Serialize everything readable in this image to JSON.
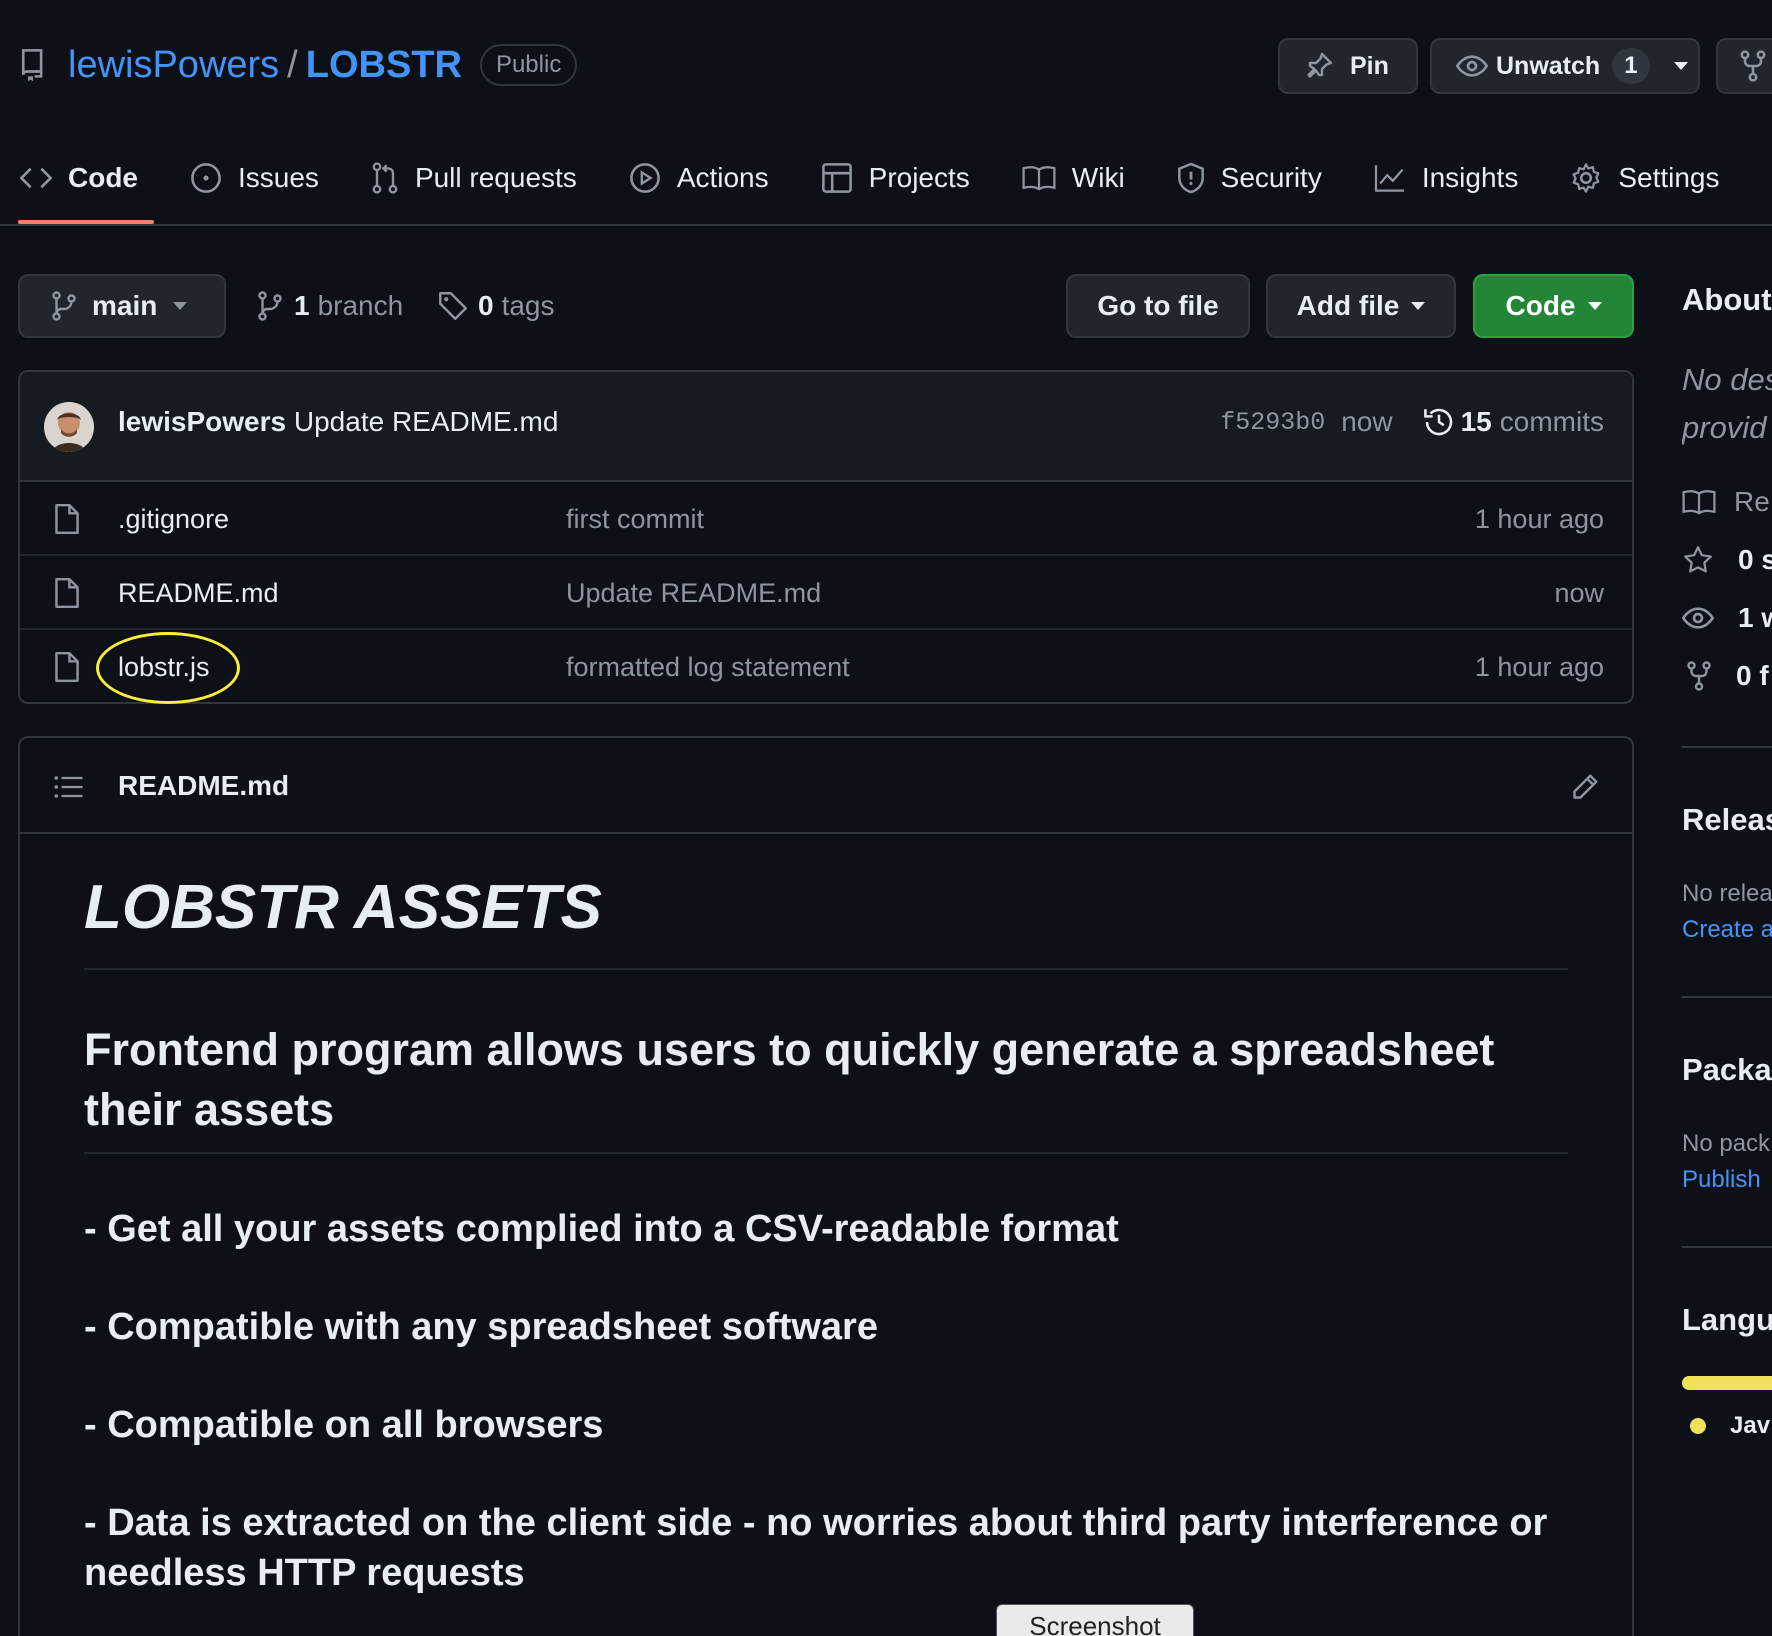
{
  "repo": {
    "owner": "lewisPowers",
    "separator": "/",
    "name": "LOBSTR",
    "visibility": "Public",
    "pin_label": "Pin",
    "watch_label": "Unwatch",
    "watch_count": "1"
  },
  "tabs": [
    {
      "label": "Code",
      "icon": "code-icon",
      "active": true
    },
    {
      "label": "Issues",
      "icon": "issue-icon"
    },
    {
      "label": "Pull requests",
      "icon": "pull-request-icon"
    },
    {
      "label": "Actions",
      "icon": "play-icon"
    },
    {
      "label": "Projects",
      "icon": "table-icon"
    },
    {
      "label": "Wiki",
      "icon": "book-icon"
    },
    {
      "label": "Security",
      "icon": "shield-icon"
    },
    {
      "label": "Insights",
      "icon": "graph-icon"
    },
    {
      "label": "Settings",
      "icon": "gear-icon"
    }
  ],
  "toolbar": {
    "branch": "main",
    "branch_count": "1",
    "branch_word": "branch",
    "tag_count": "0",
    "tag_word": "tags",
    "go_to_file": "Go to file",
    "add_file": "Add file",
    "code": "Code"
  },
  "commit": {
    "author": "lewisPowers",
    "message": "Update README.md",
    "sha": "f5293b0",
    "time": "now",
    "count": "15",
    "count_word": "commits"
  },
  "files": [
    {
      "name": ".gitignore",
      "message": "first commit",
      "time": "1 hour ago"
    },
    {
      "name": "README.md",
      "message": "Update README.md",
      "time": "now"
    },
    {
      "name": "lobstr.js",
      "message": "formatted log statement",
      "time": "1 hour ago"
    }
  ],
  "readme": {
    "filename": "README.md",
    "h1": "LOBSTR ASSETS",
    "h2_line1": "Frontend program allows users to quickly generate a spreadsheet",
    "h2_line2": "their assets",
    "items": [
      "- Get all your assets complied into a CSV-readable format",
      "- Compatible with any spreadsheet software",
      "- Compatible on all browsers"
    ],
    "item4_line1": "- Data is extracted on the client side - no worries about third party interference or",
    "item4_line2": "needless HTTP requests"
  },
  "sidebar": {
    "about": "About",
    "desc_line1": "No des",
    "desc_line2": "provid",
    "readme_stub": "Re",
    "stars": "0 s",
    "watching": "1 w",
    "forks": "0 f",
    "releases": "Releas",
    "no_releases": "No relea",
    "create_release": "Create a",
    "packages": "Packa",
    "no_packages": "No pack",
    "publish": "Publish",
    "languages": "Langu",
    "language_name": "Jav"
  },
  "tooltip": "Screenshot",
  "colors": {
    "background": "#0d1117",
    "accent_link": "#4493f8",
    "code_button": "#238636",
    "tab_underline": "#f78166",
    "language_js": "#f1e05a",
    "highlight_ellipse": "#ffeb3b"
  }
}
